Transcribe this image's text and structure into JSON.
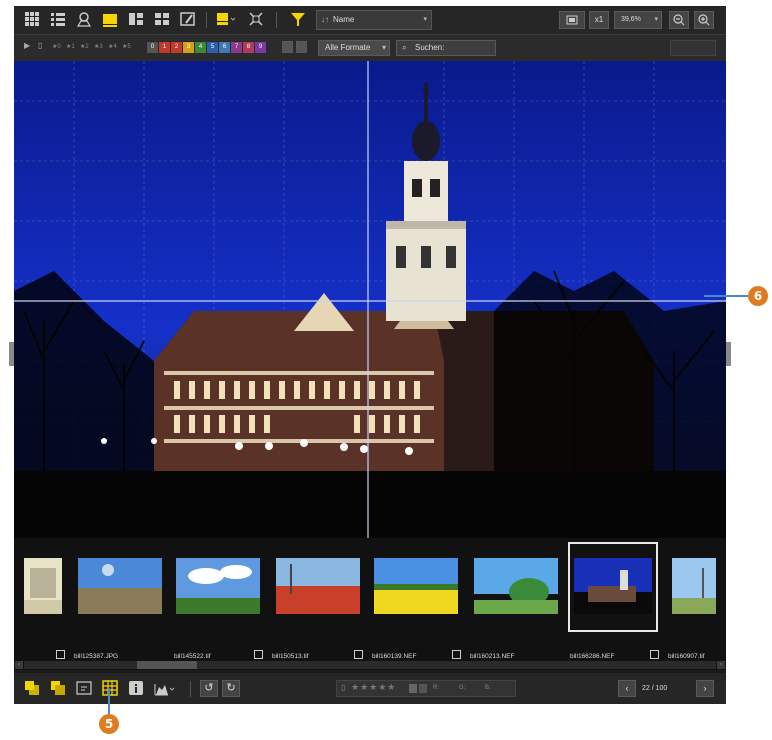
{
  "toolbar": {
    "sort_label": "Name",
    "zoom_factor": "x1",
    "zoom_percent": "39,6%"
  },
  "filterbar": {
    "rating_labels": [
      "★0",
      "★1",
      "★2",
      "★3",
      "★4",
      "★5"
    ],
    "color_labels": [
      "0",
      "1",
      "2",
      "3",
      "4",
      "5",
      "6",
      "7",
      "8",
      "9"
    ],
    "color_hex": [
      "#555555",
      "#c0392b",
      "#c0392b",
      "#d4a017",
      "#3a8a3a",
      "#2f5fa8",
      "#3a7ab8",
      "#8a3a8a",
      "#b03a5a",
      "#7a3aa0"
    ],
    "format_label": "Alle Formate",
    "search_placeholder": "Suchen:"
  },
  "filmstrip": {
    "items": [
      {
        "filename": "",
        "checked": false
      },
      {
        "filename": "bill125387.JPG",
        "checked": true
      },
      {
        "filename": "bill145522.tif",
        "checked": false
      },
      {
        "filename": "bill150513.tif",
        "checked": true
      },
      {
        "filename": "bill160139.NEF",
        "checked": true
      },
      {
        "filename": "bill160213.NEF",
        "checked": true
      },
      {
        "filename": "bill166286.NEF",
        "checked": false,
        "selected": true
      },
      {
        "filename": "bill160907.tif",
        "checked": true
      }
    ]
  },
  "bottombar": {
    "page_counter": "22 / 100",
    "label_r": "R:",
    "label_g": "G:",
    "label_b": "B:"
  },
  "callouts": {
    "grid": "5",
    "guide": "6"
  },
  "colors": {
    "accent": "#f5d400",
    "callout": "#e07b1f"
  }
}
